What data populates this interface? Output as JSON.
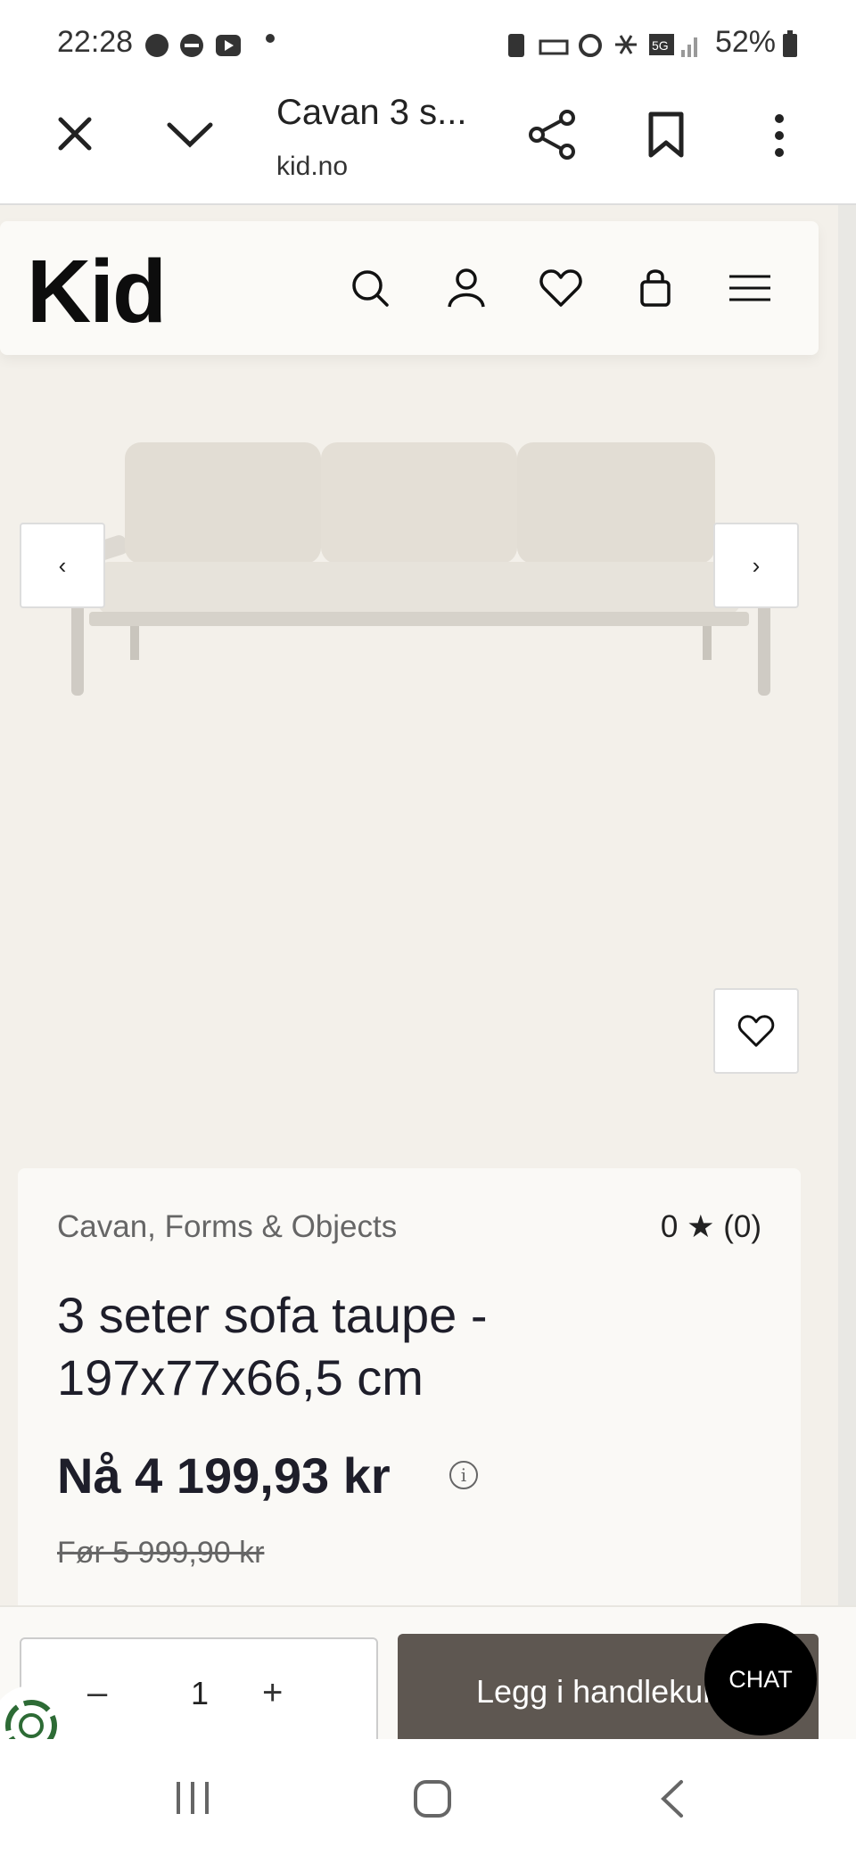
{
  "status_bar": {
    "time": "22:28",
    "battery": "52%",
    "network": "5G"
  },
  "browser": {
    "title": "Cavan 3 s...",
    "url": "kid.no",
    "icons": [
      "close-icon",
      "chevron-down-icon",
      "share-icon",
      "bookmark-icon",
      "more-vert-icon"
    ]
  },
  "site": {
    "logo": "Kid",
    "header_icons": [
      "search-icon",
      "user-icon",
      "heart-icon",
      "bag-icon",
      "menu-icon"
    ]
  },
  "carousel": {
    "prev": "‹",
    "next": "›"
  },
  "product": {
    "brand": "Cavan, Forms & Objects",
    "rating_text": "0 ★ (0)",
    "title": "3 seter sofa taupe - 197x77x66,5 cm",
    "price": "Nå 4 199,93 kr",
    "price_info": "i",
    "old_price": "Før 5 999,90 kr"
  },
  "buy": {
    "minus": "–",
    "quantity": "1",
    "plus": "+",
    "add_to_cart": "Legg i handlekurv"
  },
  "chat": {
    "label": "CHAT"
  },
  "colors": {
    "page_bg": "#f3f0ea",
    "card_bg": "#faf9f6",
    "cart_button": "#5e5751",
    "text": "#1e1e2a"
  }
}
